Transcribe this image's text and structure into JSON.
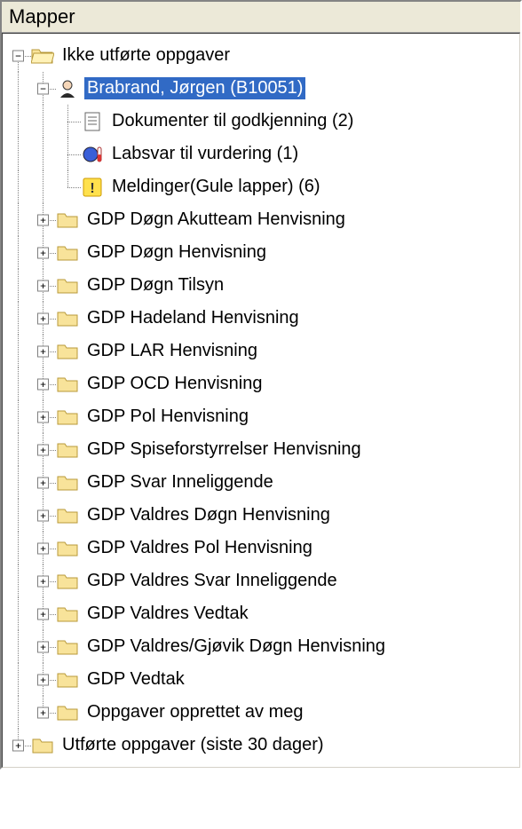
{
  "panel": {
    "title": "Mapper"
  },
  "tree": {
    "root": {
      "label": "Ikke utførte oppgaver",
      "expanded": true,
      "icon": "folder-open",
      "children": [
        {
          "label": "Brabrand, Jørgen (B10051)",
          "expanded": true,
          "selected": true,
          "icon": "person",
          "children": [
            {
              "label": "Dokumenter til godkjenning",
              "count": "(2)",
              "icon": "document"
            },
            {
              "label": "Labsvar til vurdering",
              "count": "(1)",
              "icon": "lab"
            },
            {
              "label": "Meldinger(Gule lapper)",
              "count": "(6)",
              "icon": "note-warn"
            }
          ]
        },
        {
          "label": "GDP Døgn Akutteam Henvisning",
          "expanded": false,
          "icon": "folder"
        },
        {
          "label": "GDP Døgn Henvisning",
          "expanded": false,
          "icon": "folder"
        },
        {
          "label": "GDP Døgn Tilsyn",
          "expanded": false,
          "icon": "folder"
        },
        {
          "label": "GDP Hadeland Henvisning",
          "expanded": false,
          "icon": "folder"
        },
        {
          "label": "GDP LAR Henvisning",
          "expanded": false,
          "icon": "folder"
        },
        {
          "label": "GDP OCD Henvisning",
          "expanded": false,
          "icon": "folder"
        },
        {
          "label": "GDP Pol Henvisning",
          "expanded": false,
          "icon": "folder"
        },
        {
          "label": "GDP Spiseforstyrrelser Henvisning",
          "expanded": false,
          "icon": "folder"
        },
        {
          "label": "GDP Svar Inneliggende",
          "expanded": false,
          "icon": "folder"
        },
        {
          "label": "GDP Valdres Døgn Henvisning",
          "expanded": false,
          "icon": "folder"
        },
        {
          "label": "GDP Valdres Pol Henvisning",
          "expanded": false,
          "icon": "folder"
        },
        {
          "label": "GDP Valdres Svar Inneliggende",
          "expanded": false,
          "icon": "folder"
        },
        {
          "label": "GDP Valdres Vedtak",
          "expanded": false,
          "icon": "folder"
        },
        {
          "label": "GDP Valdres/Gjøvik Døgn Henvisning",
          "expanded": false,
          "icon": "folder"
        },
        {
          "label": "GDP Vedtak",
          "expanded": false,
          "icon": "folder"
        },
        {
          "label": "Oppgaver opprettet av meg",
          "expanded": false,
          "icon": "folder"
        }
      ]
    },
    "sibling": {
      "label": "Utførte oppgaver (siste 30 dager)",
      "expanded": false,
      "icon": "folder"
    }
  },
  "glyph": {
    "plus": "+",
    "minus": "−"
  }
}
